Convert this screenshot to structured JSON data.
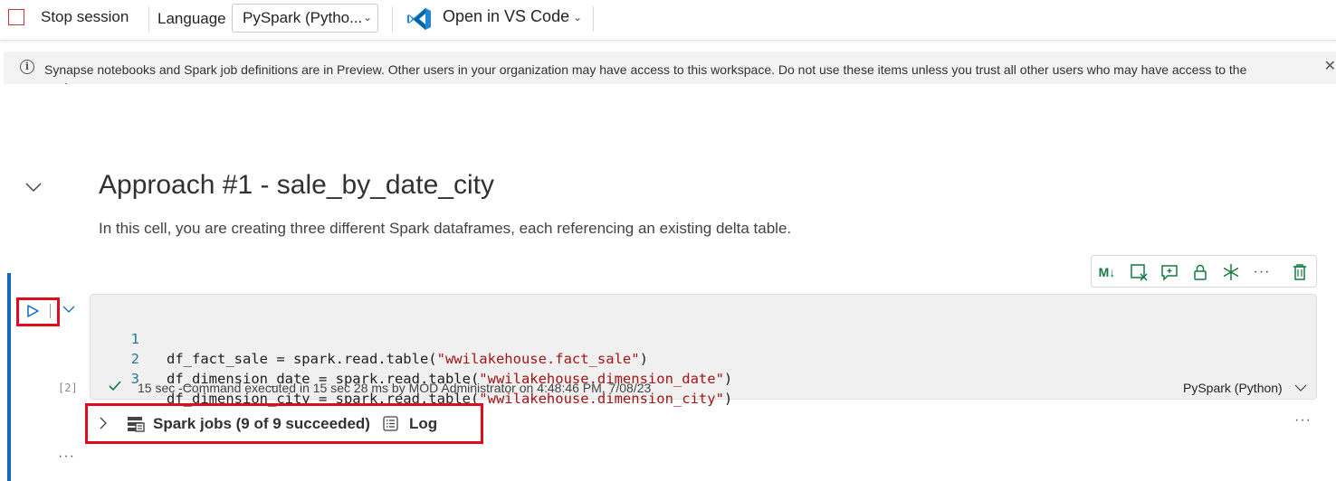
{
  "toolbar": {
    "stop_label": "Stop session",
    "language_label": "Language",
    "language_value": "PySpark (Pytho...",
    "vscode_label": "Open in VS Code"
  },
  "banner": {
    "text": "Synapse notebooks and Spark job definitions are in Preview. Other users in your organization may have access to this workspace. Do not use these items unless you trust all other users who may have access to the workspace."
  },
  "markdown_cell": {
    "heading": "Approach #1 - sale_by_date_city",
    "text": "In this cell, you are creating three different Spark dataframes, each referencing an existing delta table."
  },
  "cell_toolbar": {
    "markdown_label": "M↓"
  },
  "code_cell": {
    "execution_count": "[2]",
    "lines": [
      {
        "num": "1",
        "pre": "df_fact_sale = spark.read.table(",
        "str": "\"wwilakehouse.fact_sale\"",
        "post": ")"
      },
      {
        "num": "2",
        "pre": "df_dimension_date = spark.read.table(",
        "str": "\"wwilakehouse.dimension_date\"",
        "post": ")"
      },
      {
        "num": "3",
        "pre": "df_dimension_city = spark.read.table(",
        "str": "\"wwilakehouse.dimension_city\"",
        "post": ")"
      }
    ],
    "status": "15 sec -Command executed in 15 sec 28 ms by MOD Administrator on 4:48:46 PM, 7/08/23",
    "language": "PySpark (Python)"
  },
  "output": {
    "spark_jobs_label": "Spark jobs (9 of 9 succeeded)",
    "log_label": "Log"
  },
  "colors": {
    "accent_blue": "#0f6cbd",
    "highlight_red": "#e00b1c",
    "icon_green": "#107c41",
    "string_red": "#a31515"
  }
}
